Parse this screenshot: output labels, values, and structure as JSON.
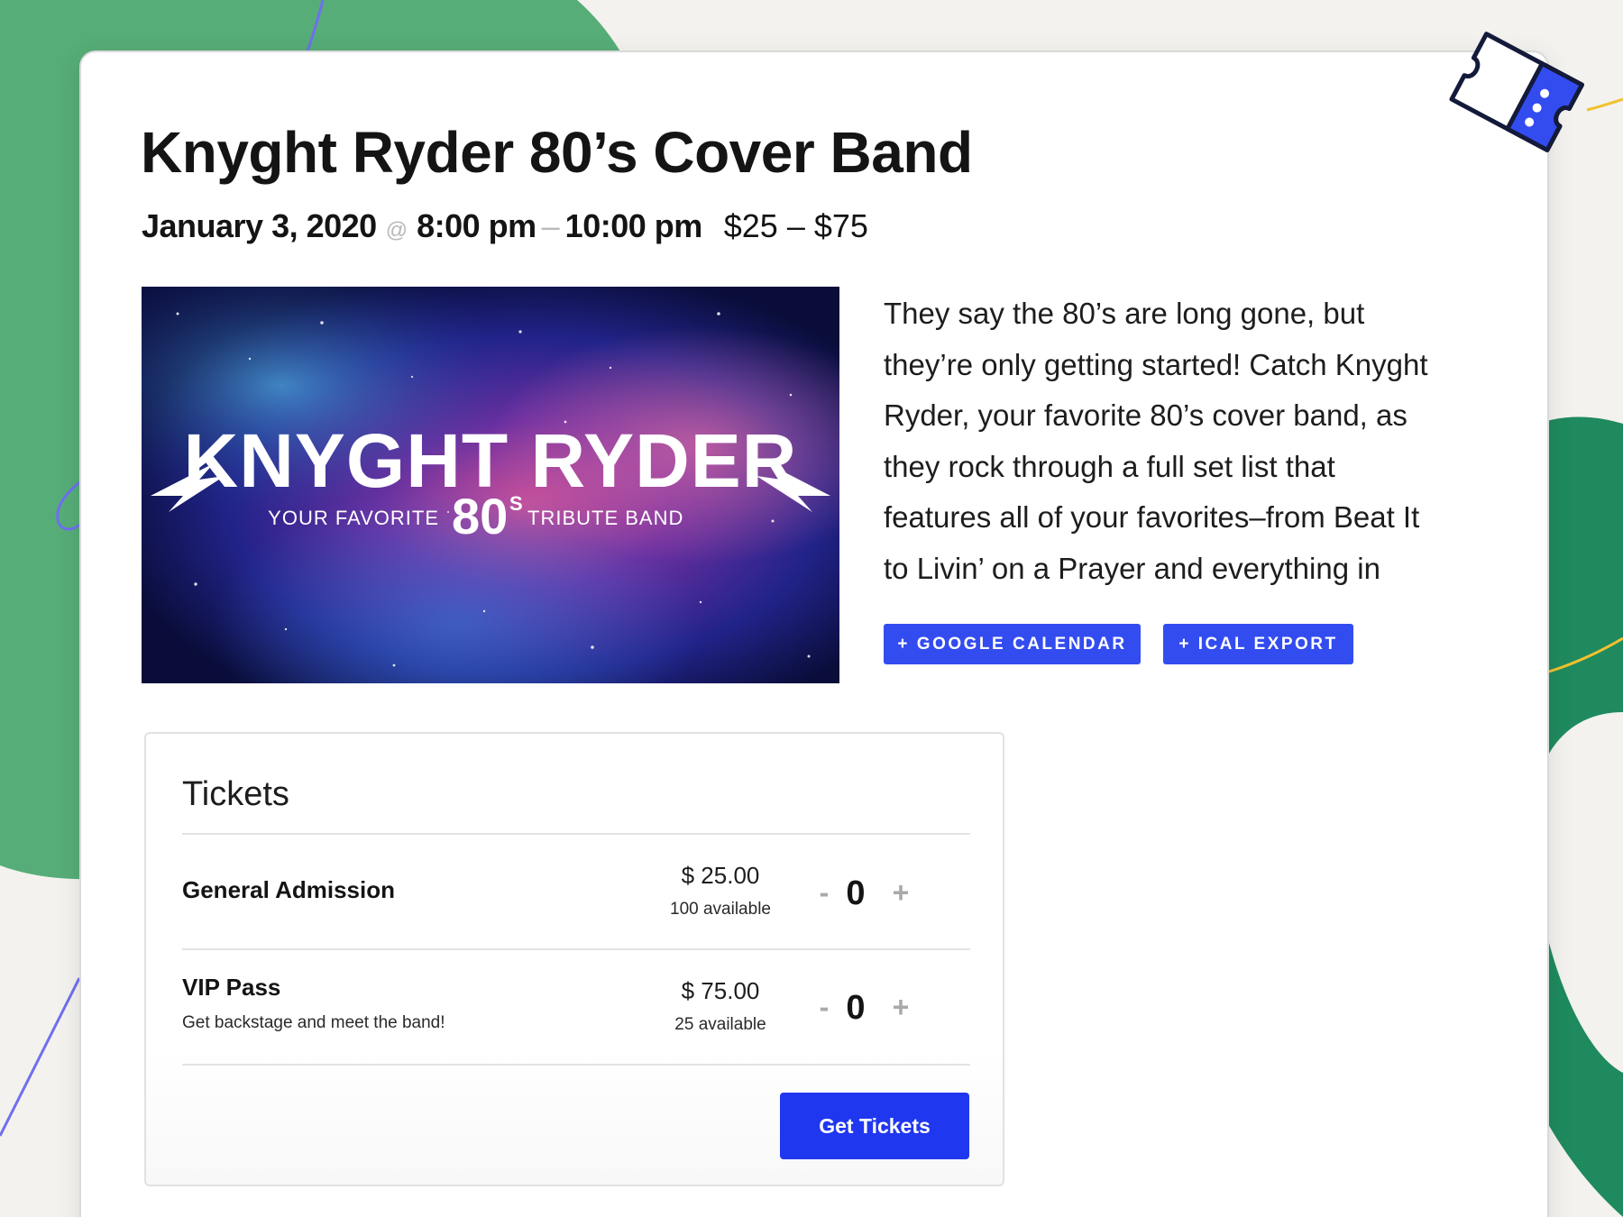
{
  "event": {
    "title": "Knyght Ryder 80’s Cover Band",
    "date": "January 3, 2020",
    "at": "@",
    "start_time": "8:00 pm",
    "dash": "–",
    "end_time": "10:00 pm",
    "price_range": "$25 – $75"
  },
  "hero_image": {
    "logo_text": "KNYGHT RYDER",
    "tagline_left": "YOUR FAVORITE",
    "tagline_80": "80",
    "tagline_s": "S",
    "tagline_right": "TRIBUTE BAND"
  },
  "description_lines": [
    "They say the 80’s are long gone, but",
    "they’re only getting started!  Catch Knyght",
    "Ryder, your favorite 80’s cover band, as",
    "they rock through a full set list that",
    "features all of your favorites–from Beat It",
    "to Livin’ on a Prayer and everything in"
  ],
  "calendar_buttons": {
    "google": "+ GOOGLE CALENDAR",
    "ical": "+ ICAL EXPORT"
  },
  "tickets": {
    "heading": "Tickets",
    "items": [
      {
        "name": "General Admission",
        "description": "",
        "price": "$ 25.00",
        "available": "100 available",
        "quantity": "0",
        "minus": "-",
        "plus": "+"
      },
      {
        "name": "VIP Pass",
        "description": "Get backstage and meet the band!",
        "price": "$ 75.00",
        "available": "25 available",
        "quantity": "0",
        "minus": "-",
        "plus": "+"
      }
    ],
    "submit_label": "Get Tickets"
  },
  "colors": {
    "accent_blue": "#334cf0",
    "button_blue": "#2037f0",
    "bg_green": "#56ad77",
    "bg_dark_green": "#1f8a5e",
    "line_yellow": "#f2c12e",
    "line_purple": "#6f6ff0"
  },
  "icons": {
    "ticket": "ticket-icon"
  }
}
